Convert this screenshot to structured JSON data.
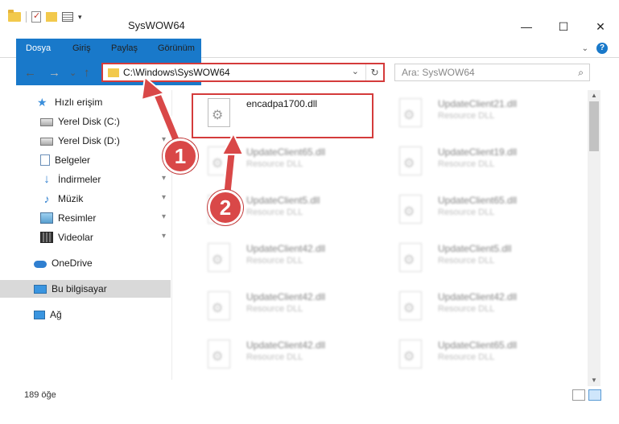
{
  "window": {
    "title": "SysWOW64",
    "minimize": "—",
    "maximize": "☐",
    "close": "✕"
  },
  "ribbon": {
    "tabs": [
      "Dosya",
      "Giriş",
      "Paylaş",
      "Görünüm"
    ],
    "expand": "⌄",
    "help": "?"
  },
  "nav": {
    "back": "←",
    "forward": "→",
    "recent": "⌄",
    "up": "↑",
    "address": "C:\\Windows\\SysWOW64",
    "address_dropdown": "⌄",
    "refresh": "↻",
    "search_placeholder": "Ara: SysWOW64",
    "search_icon": "⌕"
  },
  "sidebar": {
    "items": [
      {
        "label": "Hızlı erişim",
        "icon": "star-icon"
      },
      {
        "label": "Yerel Disk (C:)",
        "icon": "disk-icon",
        "pinned": true
      },
      {
        "label": "Yerel Disk (D:)",
        "icon": "disk-icon",
        "pinned": true
      },
      {
        "label": "Belgeler",
        "icon": "document-icon",
        "pinned": true
      },
      {
        "label": "İndirmeler",
        "icon": "download-icon",
        "pinned": true
      },
      {
        "label": "Müzik",
        "icon": "music-icon",
        "pinned": true
      },
      {
        "label": "Resimler",
        "icon": "pictures-icon",
        "pinned": true
      },
      {
        "label": "Videolar",
        "icon": "video-icon",
        "pinned": true
      },
      {
        "label": "OneDrive",
        "icon": "cloud-icon"
      },
      {
        "label": "Bu bilgisayar",
        "icon": "computer-icon",
        "selected": true
      },
      {
        "label": "Ağ",
        "icon": "network-icon"
      }
    ],
    "pin_glyph": "📌"
  },
  "files": [
    {
      "name": "encadpa1700.dll",
      "type": ""
    },
    {
      "name": "UpdateClient21.dll",
      "type": "Resource DLL"
    },
    {
      "name": "UpdateClient65.dll",
      "type": "Resource DLL"
    },
    {
      "name": "UpdateClient19.dll",
      "type": "Resource DLL"
    },
    {
      "name": "UpdateClient5.dll",
      "type": "Resource DLL"
    },
    {
      "name": "UpdateClient65.dll",
      "type": "Resource DLL"
    },
    {
      "name": "UpdateClient42.dll",
      "type": "Resource DLL"
    },
    {
      "name": "UpdateClient5.dll",
      "type": "Resource DLL"
    },
    {
      "name": "UpdateClient42.dll",
      "type": "Resource DLL"
    },
    {
      "name": "UpdateClient42.dll",
      "type": "Resource DLL"
    },
    {
      "name": "UpdateClient42.dll",
      "type": "Resource DLL"
    },
    {
      "name": "UpdateClient65.dll",
      "type": "Resource DLL"
    }
  ],
  "status": {
    "count": "189 öğe"
  },
  "callouts": {
    "one": "1",
    "two": "2"
  },
  "colors": {
    "accent": "#1979ca",
    "highlight_red": "#d43b3b",
    "callout_red": "#d94848"
  }
}
